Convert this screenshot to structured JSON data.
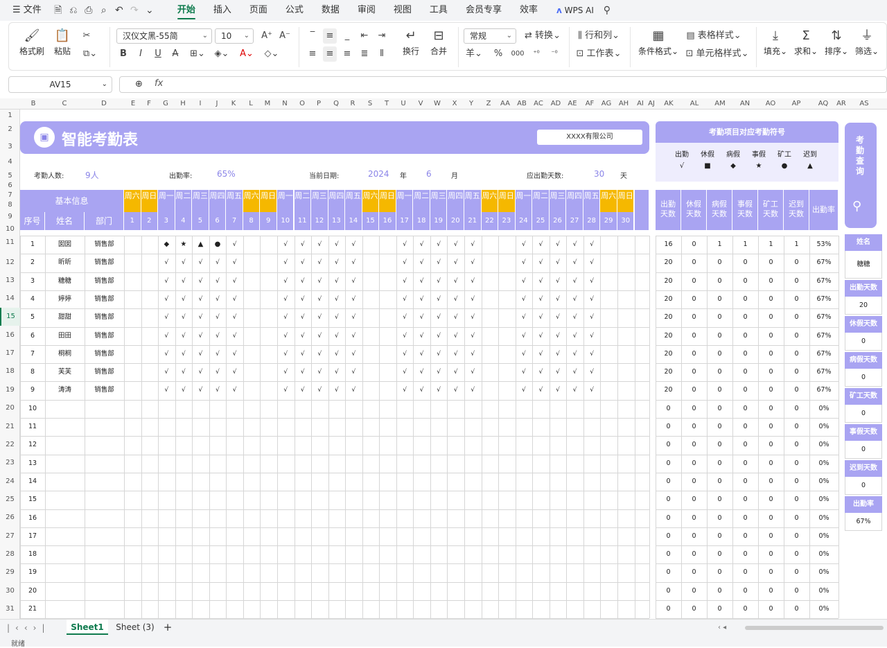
{
  "menu": {
    "file": "文件",
    "tabs": [
      "开始",
      "插入",
      "页面",
      "公式",
      "数据",
      "审阅",
      "视图",
      "工具",
      "会员专享",
      "效率"
    ],
    "ai": "WPS AI"
  },
  "ribbon": {
    "format_painter": "格式刷",
    "paste": "粘贴",
    "font_name": "汉仪文黑-55简",
    "font_size": "10",
    "wrap": "换行",
    "merge": "合并",
    "number_format": "常规",
    "convert": "转换",
    "rowcol": "行和列",
    "worksheet": "工作表",
    "cond_format": "条件格式",
    "table_style": "表格样式",
    "cell_style": "单元格样式",
    "fill": "填充",
    "sum": "求和",
    "sort": "排序",
    "filter": "筛选",
    "currency": "羊",
    "percent": "%",
    "thousand": "000"
  },
  "formula": {
    "cell_ref": "AV15",
    "fx": "fx"
  },
  "columns": [
    "B",
    "C",
    "D",
    "E",
    "F",
    "G",
    "H",
    "I",
    "J",
    "K",
    "L",
    "M",
    "N",
    "O",
    "P",
    "Q",
    "R",
    "S",
    "T",
    "U",
    "V",
    "W",
    "X",
    "Y",
    "Z",
    "AA",
    "AB",
    "AC",
    "AD",
    "AE",
    "AF",
    "AG",
    "AH",
    "AI",
    "AJ",
    "AK",
    "AL",
    "AM",
    "AN",
    "AO",
    "AP",
    "AQ",
    "AR",
    "AS"
  ],
  "rows": [
    "1",
    "2",
    "3",
    "4",
    "5",
    "6",
    "7",
    "8",
    "9",
    "10",
    "11",
    "12",
    "13",
    "14",
    "15",
    "16",
    "17",
    "18",
    "19",
    "20",
    "21",
    "22",
    "23",
    "24",
    "25",
    "26",
    "27",
    "28",
    "29",
    "30",
    "31"
  ],
  "sheet": {
    "title": "智能考勤表",
    "company": "XXXX有限公司",
    "info": {
      "headcount_label": "考勤人数:",
      "headcount": "9人",
      "rate_label": "出勤率:",
      "rate": "65%",
      "date_label": "当前日期:",
      "year": "2024",
      "year_unit": "年",
      "month": "6",
      "month_unit": "月",
      "due_label": "应出勤天数:",
      "due": "30",
      "due_unit": "天"
    },
    "basic_info": "基本信息",
    "col_seq": "序号",
    "col_name": "姓名",
    "col_dept": "部门",
    "weekdays": [
      "周六",
      "周日",
      "周一",
      "周二",
      "周三",
      "周四",
      "周五",
      "周六",
      "周日",
      "周一",
      "周二",
      "周三",
      "周四",
      "周五",
      "周六",
      "周日",
      "周一",
      "周二",
      "周三",
      "周四",
      "周五",
      "周六",
      "周日",
      "周一",
      "周二",
      "周三",
      "周四",
      "周五",
      "周六",
      "周日"
    ],
    "days": [
      "1",
      "2",
      "3",
      "4",
      "5",
      "6",
      "7",
      "8",
      "9",
      "10",
      "11",
      "12",
      "13",
      "14",
      "15",
      "16",
      "17",
      "18",
      "19",
      "20",
      "21",
      "22",
      "23",
      "24",
      "25",
      "26",
      "27",
      "28",
      "29",
      "30"
    ],
    "employees": [
      {
        "seq": "1",
        "name": "囡囡",
        "dept": "销售部",
        "marks": [
          "",
          "",
          "◆",
          "★",
          "▲",
          "●",
          "√",
          "",
          "",
          "√",
          "√",
          "√",
          "√",
          "√",
          "",
          "",
          "√",
          "√",
          "√",
          "√",
          "√",
          "",
          "",
          "√",
          "√",
          "√",
          "√",
          "√",
          "",
          ""
        ],
        "stats": [
          "16",
          "0",
          "1",
          "1",
          "1",
          "1",
          "53%"
        ]
      },
      {
        "seq": "2",
        "name": "昕昕",
        "dept": "销售部",
        "marks": [
          "",
          "",
          "√",
          "√",
          "√",
          "√",
          "√",
          "",
          "",
          "√",
          "√",
          "√",
          "√",
          "√",
          "",
          "",
          "√",
          "√",
          "√",
          "√",
          "√",
          "",
          "",
          "√",
          "√",
          "√",
          "√",
          "√",
          "",
          ""
        ],
        "stats": [
          "20",
          "0",
          "0",
          "0",
          "0",
          "0",
          "67%"
        ]
      },
      {
        "seq": "3",
        "name": "糖糖",
        "dept": "销售部",
        "marks": [
          "",
          "",
          "√",
          "√",
          "√",
          "√",
          "√",
          "",
          "",
          "√",
          "√",
          "√",
          "√",
          "√",
          "",
          "",
          "√",
          "√",
          "√",
          "√",
          "√",
          "",
          "",
          "√",
          "√",
          "√",
          "√",
          "√",
          "",
          ""
        ],
        "stats": [
          "20",
          "0",
          "0",
          "0",
          "0",
          "0",
          "67%"
        ]
      },
      {
        "seq": "4",
        "name": "婷婷",
        "dept": "销售部",
        "marks": [
          "",
          "",
          "√",
          "√",
          "√",
          "√",
          "√",
          "",
          "",
          "√",
          "√",
          "√",
          "√",
          "√",
          "",
          "",
          "√",
          "√",
          "√",
          "√",
          "√",
          "",
          "",
          "√",
          "√",
          "√",
          "√",
          "√",
          "",
          ""
        ],
        "stats": [
          "20",
          "0",
          "0",
          "0",
          "0",
          "0",
          "67%"
        ]
      },
      {
        "seq": "5",
        "name": "甜甜",
        "dept": "销售部",
        "marks": [
          "",
          "",
          "√",
          "√",
          "√",
          "√",
          "√",
          "",
          "",
          "√",
          "√",
          "√",
          "√",
          "√",
          "",
          "",
          "√",
          "√",
          "√",
          "√",
          "√",
          "",
          "",
          "√",
          "√",
          "√",
          "√",
          "√",
          "",
          ""
        ],
        "stats": [
          "20",
          "0",
          "0",
          "0",
          "0",
          "0",
          "67%"
        ]
      },
      {
        "seq": "6",
        "name": "田田",
        "dept": "销售部",
        "marks": [
          "",
          "",
          "√",
          "√",
          "√",
          "√",
          "√",
          "",
          "",
          "√",
          "√",
          "√",
          "√",
          "√",
          "",
          "",
          "√",
          "√",
          "√",
          "√",
          "√",
          "",
          "",
          "√",
          "√",
          "√",
          "√",
          "√",
          "",
          ""
        ],
        "stats": [
          "20",
          "0",
          "0",
          "0",
          "0",
          "0",
          "67%"
        ]
      },
      {
        "seq": "7",
        "name": "桐桐",
        "dept": "销售部",
        "marks": [
          "",
          "",
          "√",
          "√",
          "√",
          "√",
          "√",
          "",
          "",
          "√",
          "√",
          "√",
          "√",
          "√",
          "",
          "",
          "√",
          "√",
          "√",
          "√",
          "√",
          "",
          "",
          "√",
          "√",
          "√",
          "√",
          "√",
          "",
          ""
        ],
        "stats": [
          "20",
          "0",
          "0",
          "0",
          "0",
          "0",
          "67%"
        ]
      },
      {
        "seq": "8",
        "name": "芙芙",
        "dept": "销售部",
        "marks": [
          "",
          "",
          "√",
          "√",
          "√",
          "√",
          "√",
          "",
          "",
          "√",
          "√",
          "√",
          "√",
          "√",
          "",
          "",
          "√",
          "√",
          "√",
          "√",
          "√",
          "",
          "",
          "√",
          "√",
          "√",
          "√",
          "√",
          "",
          ""
        ],
        "stats": [
          "20",
          "0",
          "0",
          "0",
          "0",
          "0",
          "67%"
        ]
      },
      {
        "seq": "9",
        "name": "涛涛",
        "dept": "销售部",
        "marks": [
          "",
          "",
          "√",
          "√",
          "√",
          "√",
          "√",
          "",
          "",
          "√",
          "√",
          "√",
          "√",
          "√",
          "",
          "",
          "√",
          "√",
          "√",
          "√",
          "√",
          "",
          "",
          "√",
          "√",
          "√",
          "√",
          "√",
          "",
          ""
        ],
        "stats": [
          "20",
          "0",
          "0",
          "0",
          "0",
          "0",
          "67%"
        ]
      }
    ],
    "empty_seq": [
      "10",
      "11",
      "12",
      "13",
      "14",
      "15",
      "16",
      "17",
      "18",
      "19",
      "20",
      "21"
    ],
    "empty_stats": [
      "0",
      "0",
      "0",
      "0",
      "0",
      "0",
      "0%"
    ],
    "legend": {
      "title": "考勤项目对应考勤符号",
      "items": [
        {
          "label": "出勤",
          "sym": "√"
        },
        {
          "label": "休假",
          "sym": "■"
        },
        {
          "label": "病假",
          "sym": "◆"
        },
        {
          "label": "事假",
          "sym": "★"
        },
        {
          "label": "矿工",
          "sym": "●"
        },
        {
          "label": "迟到",
          "sym": "▲"
        }
      ]
    },
    "stat_headers": [
      [
        "出勤",
        "天数"
      ],
      [
        "休假",
        "天数"
      ],
      [
        "病假",
        "天数"
      ],
      [
        "事假",
        "天数"
      ],
      [
        "矿工",
        "天数"
      ],
      [
        "迟到",
        "天数"
      ],
      [
        "出勤率",
        ""
      ]
    ],
    "lookup": {
      "button": "考勤查询",
      "items": [
        {
          "label": "姓名",
          "value": "糖糖"
        },
        {
          "label": "出勤天数",
          "value": "20"
        },
        {
          "label": "休假天数",
          "value": "0"
        },
        {
          "label": "病假天数",
          "value": "0"
        },
        {
          "label": "矿工天数",
          "value": "0"
        },
        {
          "label": "事假天数",
          "value": "0"
        },
        {
          "label": "迟到天数",
          "value": "0"
        },
        {
          "label": "出勤率",
          "value": "67%"
        }
      ]
    }
  },
  "tabs": {
    "active": "Sheet1",
    "other": "Sheet (3)",
    "add": "+"
  },
  "status": "就绪",
  "colors": {
    "accent": "#0f7b4e",
    "lavender": "#a9a4f2",
    "weekend": "#f5b800"
  }
}
